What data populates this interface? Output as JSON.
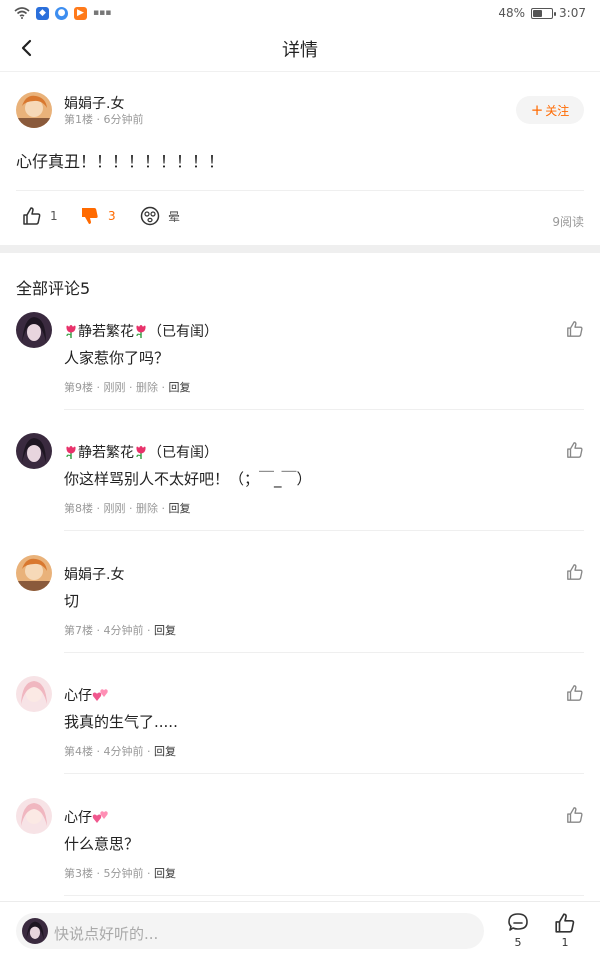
{
  "status_bar": {
    "battery_text": "48%",
    "battery_level": 0.48,
    "time": "3:07"
  },
  "header": {
    "title": "详情"
  },
  "post": {
    "author": "娟娟子.女",
    "meta": "第1楼 · 6分钟前",
    "follow_label": "关注",
    "content": "心仔真丑！！！！！！！！！",
    "likes": "1",
    "dislikes": "3",
    "emoji_label": "晕",
    "read_count": "9阅读"
  },
  "comments_title": "全部评论5",
  "comments": [
    {
      "name": "静若繁花",
      "name_suffix": "（已有闺）",
      "text": "人家惹你了吗？",
      "meta": "第9楼 · 刚刚 · ",
      "delete_label": "删除",
      "reply_label": "回复"
    },
    {
      "name": "静若繁花",
      "name_suffix": "（已有闺）",
      "text": "你这样骂别人不太好吧！（；￣_￣）",
      "meta": "第8楼 · 刚刚 · ",
      "delete_label": "删除",
      "reply_label": "回复"
    },
    {
      "name": "娟娟子.女",
      "text": "切",
      "meta": "第7楼 · 4分钟前 · ",
      "reply_label": "回复"
    },
    {
      "name": "心仔",
      "text": "我真的生气了.....",
      "meta": "第4楼 · 4分钟前 · ",
      "reply_label": "回复"
    },
    {
      "name": "心仔",
      "text": "什么意思？",
      "meta": "第3楼 · 5分钟前 · ",
      "reply_label": "回复"
    }
  ],
  "bottom_bar": {
    "placeholder": "快说点好听的...",
    "comment_count": "5",
    "like_count": "1"
  },
  "colors": {
    "accent": "#ff6a00",
    "divider": "#efefef",
    "muted_text": "#999999"
  },
  "icons": {
    "back": "back-arrow-icon",
    "like": "thumbs-up-icon",
    "dislike": "thumbs-down-icon",
    "emoji": "dizzy-face-icon",
    "comment": "comment-bubble-icon",
    "tulip": "tulip-icon",
    "hearts": "two-hearts-icon"
  }
}
